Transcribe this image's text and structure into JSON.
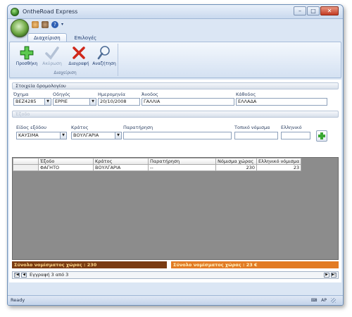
{
  "window": {
    "title": "OntheRoad Express"
  },
  "ribbon": {
    "tabs": [
      {
        "label": "Διαχείριση"
      },
      {
        "label": "Επιλογές"
      }
    ],
    "buttons": {
      "add": "Προσθήκη",
      "cancel": "Ακύρωση",
      "delete": "Διαγραφή",
      "search": "Αναζήτηση"
    },
    "group_title": "Διαχείριση"
  },
  "trip": {
    "section_title": "Στοιχεία δρομολογίου",
    "labels": {
      "vehicle": "Όχημα",
      "driver": "Οδηγός",
      "date": "Ημερομηνία",
      "departure": "Άνοδος",
      "arrival": "Κάθοδος"
    },
    "values": {
      "vehicle": "ΒΕΖ4285",
      "driver": "ΕΡΡΙΕ",
      "date": "20/10/2008",
      "departure": "ΓΑΛΛΙΑ",
      "arrival": "ΕΛΛΑΔΑ"
    }
  },
  "expense": {
    "section_title": "Έξοδο",
    "labels": {
      "type": "Είδος εξόδου",
      "country": "Κράτος",
      "note": "Παρατήρηση",
      "local_currency": "Τοπικό νόμισμα",
      "greek": "Ελληνικό"
    },
    "values": {
      "type": "ΚΑΥΣΙΜΑ",
      "country": "ΒΟΥΛΓΑΡΙΑ",
      "note": "",
      "local_currency": "",
      "greek": ""
    }
  },
  "grid": {
    "columns": [
      "Έξοδο",
      "Κράτος",
      "Παρατήρηση",
      "Νόμισμα χώρας",
      "Ελληνικό νόμισμα"
    ],
    "rows": [
      [
        "ΦΑΓΗΤΟ",
        "ΒΟΥΛΓΑΡΙΑ",
        "--",
        "230",
        "23"
      ]
    ]
  },
  "totals": {
    "local": "Σύνολο νομίσματος χώρας : 230",
    "greek": "Σύνολο νομίσματος χώρας : 23 €"
  },
  "navigator": {
    "record": "Εγγραφή 3 από 3"
  },
  "status": {
    "text": "Ready",
    "lang": "AP"
  },
  "colors": {
    "total_local_bg": "#7a3b12",
    "total_greek_bg": "#e27b24",
    "grid_bg": "#8c8c8c"
  }
}
